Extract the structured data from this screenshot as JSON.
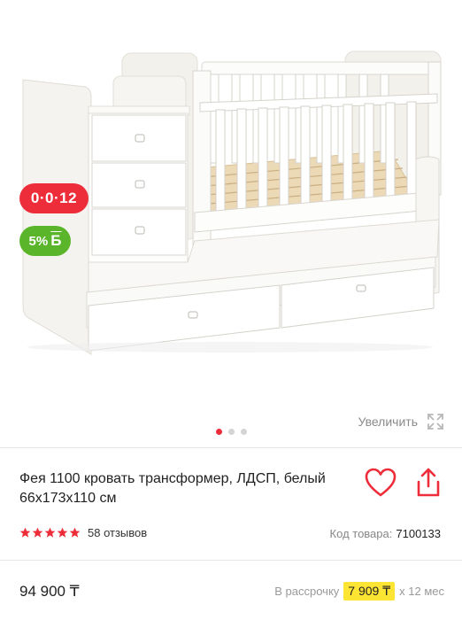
{
  "gallery": {
    "image_alt": "Детская кровать-трансформер белая с комодом и ящиками",
    "badges": {
      "installment": "0·0·12",
      "bonus_percent": "5%",
      "bonus_letter": "Б"
    },
    "zoom_label": "Увеличить",
    "dots_total": 3,
    "active_dot": 1
  },
  "product": {
    "title": "Фея 1100 кровать трансформер, ЛДСП, белый 66x173x110 см",
    "rating": 5,
    "reviews": "58 отзывов",
    "sku_label": "Код товара:",
    "sku_value": "7100133"
  },
  "pricing": {
    "price": "94 900 ₸",
    "installment_label": "В рассрочку",
    "installment_amount": "7 909 ₸",
    "installment_term": "x 12 мес"
  },
  "colors": {
    "accent_red": "#ee2d3b",
    "bonus_green": "#5bb52b",
    "highlight_yellow": "#ffe533",
    "star_color": "#ee2d3b"
  },
  "icons": {
    "favorite": "heart-icon",
    "share": "share-icon",
    "zoom": "expand-icon",
    "rating": "star-icon"
  }
}
